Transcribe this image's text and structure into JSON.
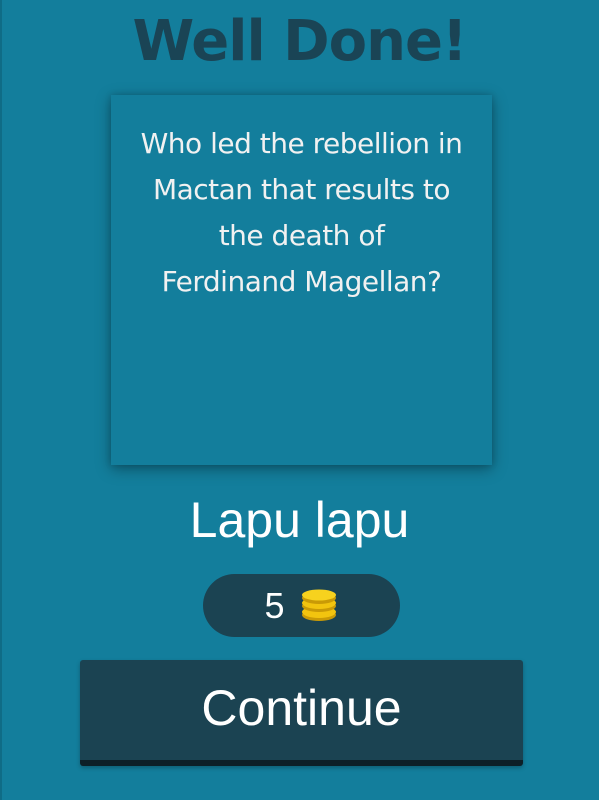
{
  "header": {
    "title": "Well Done!"
  },
  "question": {
    "lines": [
      "Who led the rebellion in",
      "Mactan that results to",
      "the death of",
      "Ferdinand Magellan?"
    ]
  },
  "answer": {
    "text": "Lapu lapu"
  },
  "reward": {
    "coins": "5",
    "icon": "coin-stack-icon",
    "icon_color": "#f2c40f"
  },
  "actions": {
    "continue_label": "Continue"
  },
  "colors": {
    "background": "#137e9c",
    "title": "#1a4455",
    "dark_panel": "#1b4352"
  }
}
